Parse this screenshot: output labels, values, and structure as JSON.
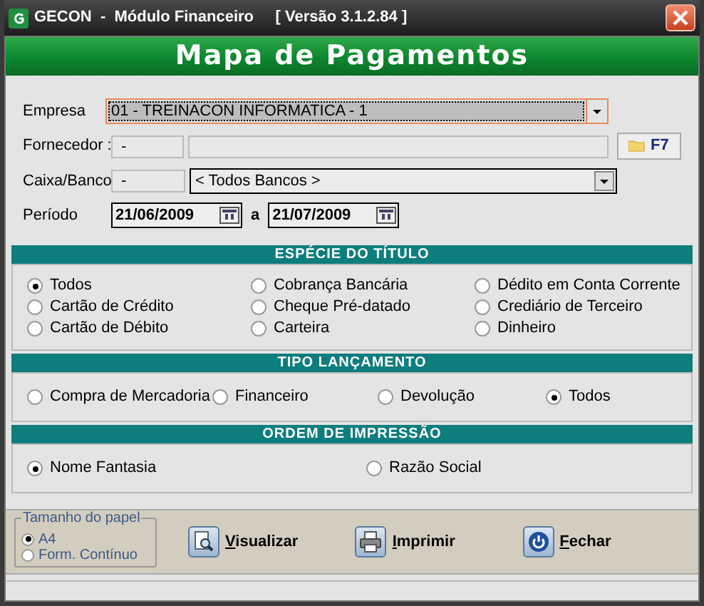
{
  "window": {
    "title": "GECON  -  Módulo Financeiro     [ Versão 3.1.2.84 ]"
  },
  "banner": "Mapa de Pagamentos",
  "fields": {
    "empresa": {
      "label": "Empresa",
      "value": "01 - TREINACON INFORMATICA - 1",
      "focused": true
    },
    "fornecedor": {
      "label": "Fornecedor :",
      "code": "-",
      "button": "F7"
    },
    "caixa": {
      "label": "Caixa/Banco",
      "code": "-",
      "value": "< Todos Bancos >"
    },
    "periodo": {
      "label": "Período",
      "from": "21/06/2009",
      "sep": "a",
      "to": "21/07/2009"
    }
  },
  "sections": [
    {
      "title": "ESPÉCIE DO TÍTULO",
      "options": [
        {
          "label": "Todos",
          "selected": true
        },
        {
          "label": "Cobrança Bancária",
          "selected": false
        },
        {
          "label": "Dédito em Conta Corrente",
          "selected": false
        },
        {
          "label": "Cartão de Crédito",
          "selected": false
        },
        {
          "label": "Cheque Pré-datado",
          "selected": false
        },
        {
          "label": "Crediário de Terceiro",
          "selected": false
        },
        {
          "label": "Cartão de Débito",
          "selected": false
        },
        {
          "label": "Carteira",
          "selected": false
        },
        {
          "label": "Dinheiro",
          "selected": false
        }
      ]
    },
    {
      "title": "TIPO LANÇAMENTO",
      "options": [
        {
          "label": "Compra de Mercadoria",
          "selected": false
        },
        {
          "label": "Financeiro",
          "selected": false
        },
        {
          "label": "Devolução",
          "selected": false
        },
        {
          "label": "Todos",
          "selected": true
        }
      ]
    },
    {
      "title": "ORDEM DE IMPRESSÃO",
      "options": [
        {
          "label": "Nome Fantasia",
          "selected": true
        },
        {
          "label": "Razão Social",
          "selected": false
        }
      ]
    }
  ],
  "paper": {
    "title": "Tamanho do papel",
    "options": [
      {
        "label": "A4",
        "selected": true
      },
      {
        "label": "Form. Contínuo",
        "selected": false
      }
    ]
  },
  "actions": [
    {
      "kind": "preview",
      "label": "Visualizar"
    },
    {
      "kind": "print",
      "label": "Imprimir"
    },
    {
      "kind": "close",
      "label": "Fechar"
    }
  ]
}
